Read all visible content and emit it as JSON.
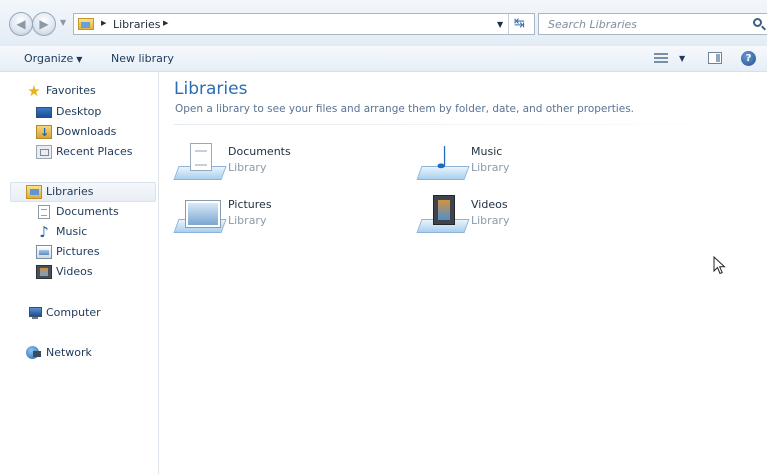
{
  "address_bar": {
    "breadcrumb": "Libraries",
    "search_placeholder": "Search Libraries"
  },
  "toolbar": {
    "organize_label": "Organize",
    "new_library_label": "New library"
  },
  "nav": {
    "favorites_label": "Favorites",
    "favorites": [
      "Desktop",
      "Downloads",
      "Recent Places"
    ],
    "libraries_label": "Libraries",
    "libraries": [
      "Documents",
      "Music",
      "Pictures",
      "Videos"
    ],
    "computer_label": "Computer",
    "network_label": "Network"
  },
  "content": {
    "title": "Libraries",
    "subtitle": "Open a library to see your files and arrange them by folder, date, and other properties.",
    "items": [
      {
        "name": "Documents",
        "type": "Library",
        "icon": "documents-library-icon"
      },
      {
        "name": "Music",
        "type": "Library",
        "icon": "music-library-icon"
      },
      {
        "name": "Pictures",
        "type": "Library",
        "icon": "pictures-library-icon"
      },
      {
        "name": "Videos",
        "type": "Library",
        "icon": "videos-library-icon"
      }
    ]
  },
  "colors": {
    "title": "#2a6db2",
    "text": "#1e395b",
    "secondary_text": "#8c9aa8"
  }
}
